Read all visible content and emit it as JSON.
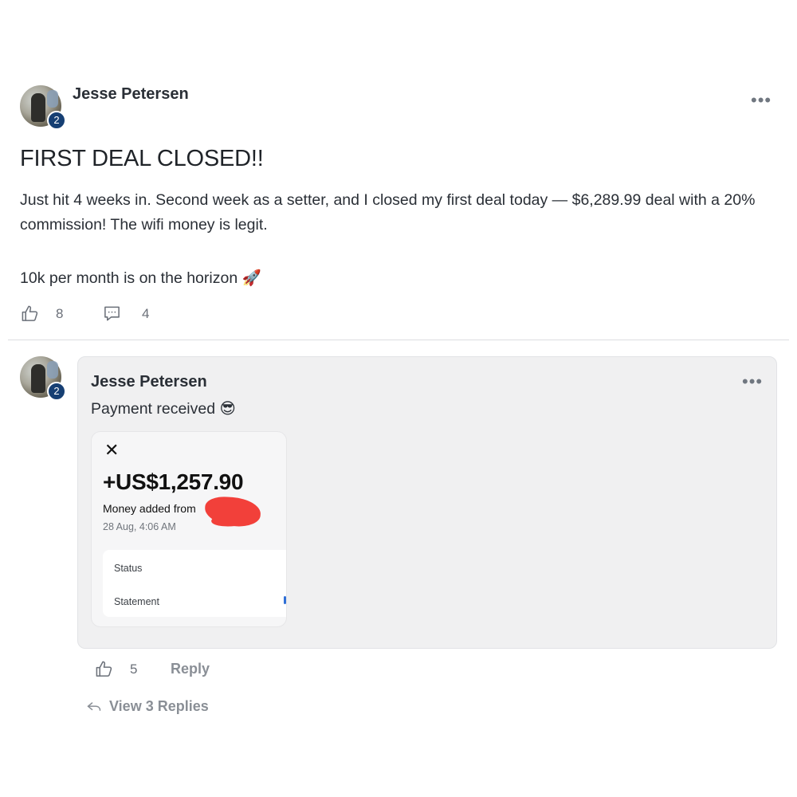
{
  "post": {
    "author": "Jesse Petersen",
    "level": "2",
    "title": "FIRST DEAL CLOSED!!",
    "body_line1": "Just hit 4 weeks in. Second week as a setter, and I closed my first deal today — $6,289.99 deal with a 20% commission! The wifi money is legit.",
    "body_line2": "10k per month is on the horizon 🚀",
    "likes": "8",
    "comments": "4",
    "more_label": "•••"
  },
  "comment": {
    "author": "Jesse Petersen",
    "level": "2",
    "text": "Payment received 😎",
    "more_label": "•••",
    "likes": "5",
    "reply_label": "Reply",
    "view_replies_label": "View 3 Replies"
  },
  "receipt": {
    "close_glyph": "✕",
    "amount": "+US$1,257.90",
    "from_label": "Money added from",
    "date": "28 Aug, 4:06 AM",
    "status_label": "Status",
    "statement_label": "Statement"
  },
  "colors": {
    "badge": "#163f73",
    "comment_bg": "#f0f0f1",
    "redaction": "#f2403a"
  }
}
